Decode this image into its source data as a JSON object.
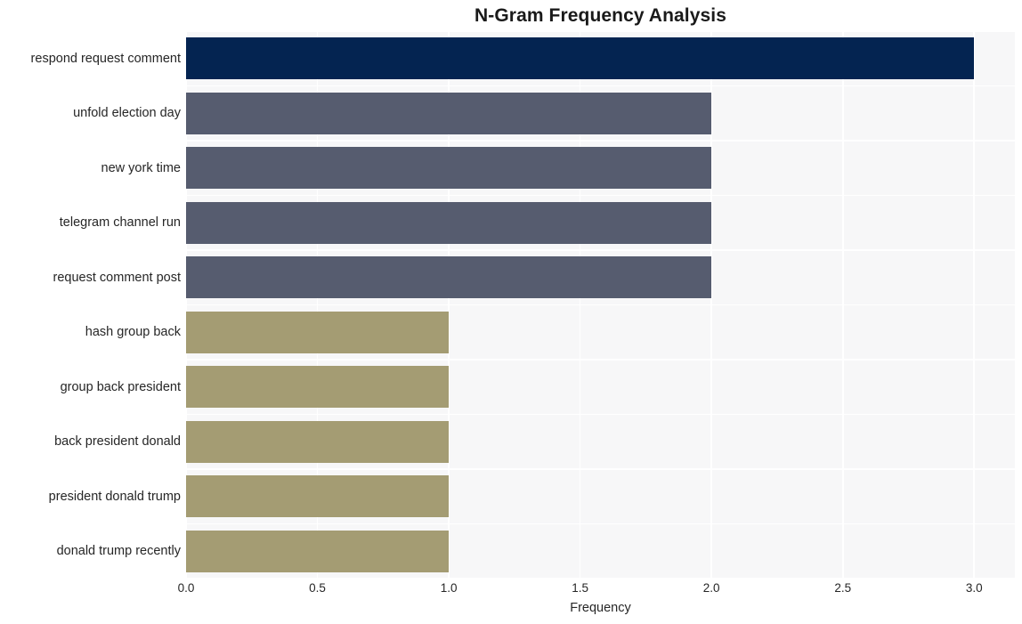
{
  "chart_data": {
    "type": "bar",
    "orientation": "horizontal",
    "title": "N-Gram Frequency Analysis",
    "xlabel": "Frequency",
    "ylabel": "",
    "xlim": [
      0,
      3.155
    ],
    "xticks": [
      "0.0",
      "0.5",
      "1.0",
      "1.5",
      "2.0",
      "2.5",
      "3.0"
    ],
    "xtick_values": [
      0.0,
      0.5,
      1.0,
      1.5,
      2.0,
      2.5,
      3.0
    ],
    "grid": true,
    "legend": "none",
    "categories": [
      "respond request comment",
      "unfold election day",
      "new york time",
      "telegram channel run",
      "request comment post",
      "hash group back",
      "group back president",
      "back president donald",
      "president donald trump",
      "donald trump recently"
    ],
    "values": [
      3,
      2,
      2,
      2,
      2,
      1,
      1,
      1,
      1,
      1
    ],
    "bar_colors": [
      "#042451",
      "#565c6f",
      "#565c6f",
      "#565c6f",
      "#565c6f",
      "#a49c73",
      "#a49c73",
      "#a49c73",
      "#a49c73",
      "#a49c73"
    ]
  },
  "style": {
    "plot_background": "#f7f7f8",
    "grid_color": "#ffffff",
    "figure_background": "#ffffff",
    "title_color": "#1a1a1a",
    "tick_color": "#262626"
  }
}
